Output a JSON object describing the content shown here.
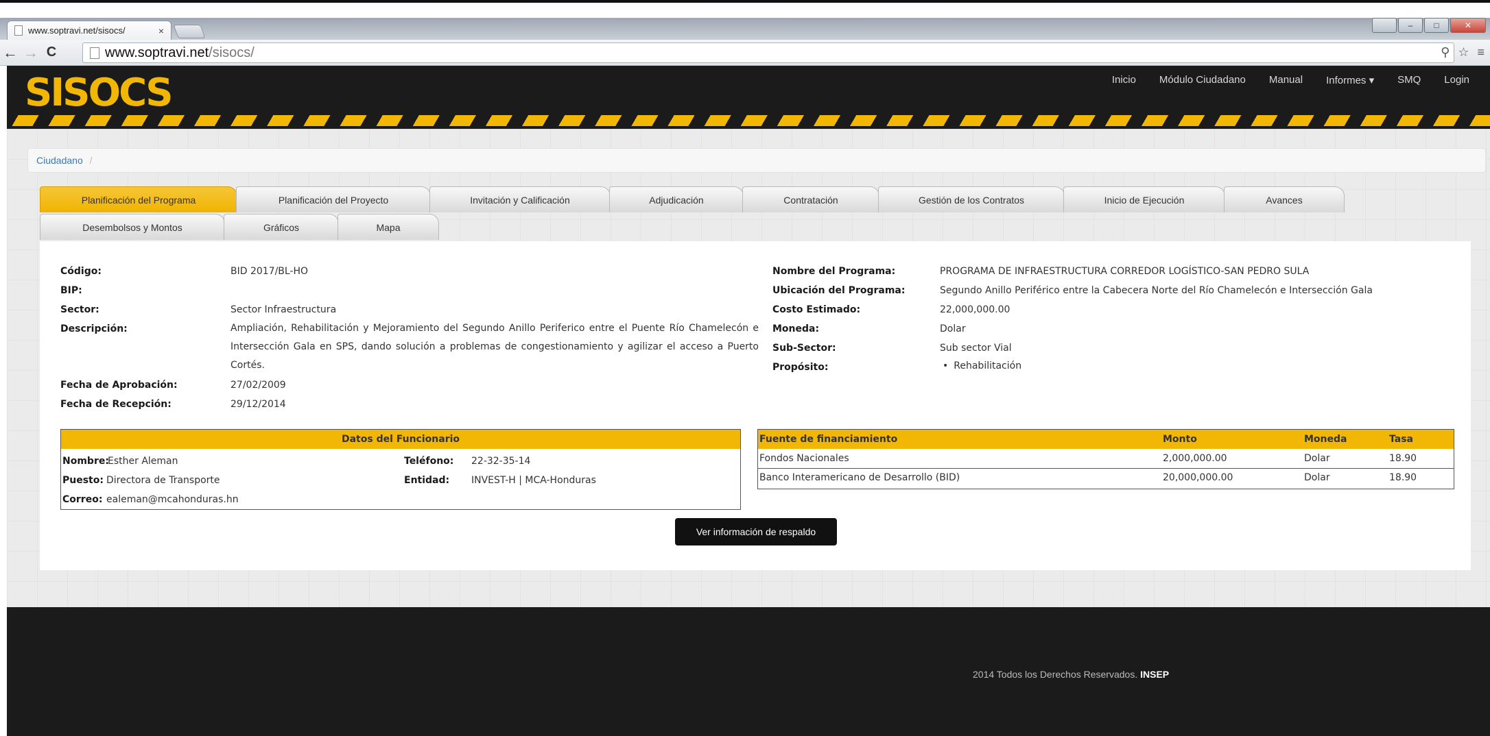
{
  "browser": {
    "tab_title": "www.soptravi.net/sisocs/",
    "tab_close": "×",
    "url_host": "www.soptravi.net",
    "url_path": "/sisocs/",
    "back": "←",
    "forward": "→",
    "reload": "C"
  },
  "site": {
    "logo": "SISOCS",
    "nav": [
      "Inicio",
      "Módulo Ciudadano",
      "Manual",
      "Informes ▾",
      "SMQ",
      "Login"
    ]
  },
  "breadcrumb": {
    "item": "Ciudadano",
    "separator": "/"
  },
  "tabs": {
    "row1": [
      "Planificación del Programa",
      "Planificación del Proyecto",
      "Invitación y Calificación",
      "Adjudicación",
      "Contratación",
      "Gestión de los Contratos",
      "Inicio de Ejecución",
      "Avances"
    ],
    "row2": [
      "Desembolsos y Montos",
      "Gráficos",
      "Mapa"
    ],
    "active": "Planificación del Programa"
  },
  "programa": {
    "labels": {
      "codigo": "Código:",
      "bip": "BIP:",
      "sector": "Sector:",
      "descripcion": "Descripción:",
      "fecha_aprobacion": "Fecha de Aprobación:",
      "fecha_recepcion": "Fecha de Recepción:",
      "nombre": "Nombre del Programa:",
      "ubicacion": "Ubicación del Programa:",
      "costo": "Costo Estimado:",
      "moneda": "Moneda:",
      "subsector": "Sub-Sector:",
      "proposito": "Propósito:"
    },
    "values": {
      "codigo": "BID 2017/BL-HO",
      "bip": "",
      "sector": "Sector Infraestructura",
      "descripcion": "Ampliación, Rehabilitación y Mejoramiento del Segundo Anillo Periferico entre el Puente Río Chamelecón e Intersección Gala en SPS, dando solución a problemas de congestionamiento y agilizar el acceso a Puerto Cortés.",
      "fecha_aprobacion": "27/02/2009",
      "fecha_recepcion": "29/12/2014",
      "nombre": "PROGRAMA DE INFRAESTRUCTURA CORREDOR LOGÍSTICO-SAN PEDRO SULA",
      "ubicacion": "Segundo Anillo Periférico entre la Cabecera Norte del Río Chamelecón e Intersección Gala",
      "costo": "22,000,000.00",
      "moneda": "Dolar",
      "subsector": "Sub sector Vial",
      "proposito": "Rehabilitación"
    }
  },
  "funcionario": {
    "title": "Datos del Funcionario",
    "labels": {
      "nombre": "Nombre:",
      "puesto": "Puesto:",
      "correo": "Correo:",
      "telefono": "Teléfono:",
      "entidad": "Entidad:"
    },
    "values": {
      "nombre": "Esther Aleman",
      "puesto": "Directora de Transporte",
      "correo": "ealeman@mcahonduras.hn",
      "telefono": "22-32-35-14",
      "entidad": "INVEST-H | MCA-Honduras"
    }
  },
  "financiamiento": {
    "headers": [
      "Fuente de financiamiento",
      "Monto",
      "Moneda",
      "Tasa"
    ],
    "rows": [
      [
        "Fondos Nacionales",
        "2,000,000.00",
        "Dolar",
        "18.90"
      ],
      [
        "Banco Interamericano de Desarrollo (BID)",
        "20,000,000.00",
        "Dolar",
        "18.90"
      ]
    ]
  },
  "respaldo_button": "Ver información de respaldo",
  "footer": {
    "text": "2014 Todos los Derechos Reservados.",
    "brand": "INSEP"
  },
  "colors": {
    "brand_yellow": "#f2b705",
    "header_dark": "#1b1b1b",
    "link_blue": "#3a77b8"
  }
}
